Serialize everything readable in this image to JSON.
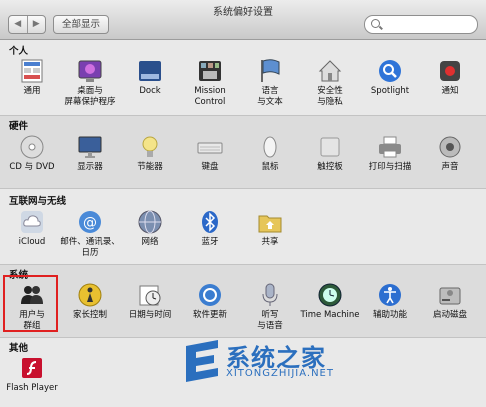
{
  "window": {
    "title": "系统偏好设置"
  },
  "toolbar": {
    "back_glyph": "◀",
    "forward_glyph": "▶",
    "show_all_label": "全部显示",
    "search_placeholder": ""
  },
  "sections": {
    "personal": {
      "title": "个人",
      "items": [
        {
          "label": "通用"
        },
        {
          "label": "桌面与\n屏幕保护程序"
        },
        {
          "label": "Dock"
        },
        {
          "label": "Mission\nControl"
        },
        {
          "label": "语言\n与文本"
        },
        {
          "label": "安全性\n与隐私"
        },
        {
          "label": "Spotlight"
        },
        {
          "label": "通知"
        }
      ]
    },
    "hardware": {
      "title": "硬件",
      "items": [
        {
          "label": "CD 与 DVD"
        },
        {
          "label": "显示器"
        },
        {
          "label": "节能器"
        },
        {
          "label": "键盘"
        },
        {
          "label": "鼠标"
        },
        {
          "label": "触控板"
        },
        {
          "label": "打印与扫描"
        },
        {
          "label": "声音"
        }
      ]
    },
    "internet": {
      "title": "互联网与无线",
      "items": [
        {
          "label": "iCloud"
        },
        {
          "label": "邮件、通讯录、\n日历"
        },
        {
          "label": "网络"
        },
        {
          "label": "蓝牙"
        },
        {
          "label": "共享"
        }
      ]
    },
    "system": {
      "title": "系统",
      "items": [
        {
          "label": "用户与\n群组"
        },
        {
          "label": "家长控制"
        },
        {
          "label": "日期与时间"
        },
        {
          "label": "软件更新"
        },
        {
          "label": "听写\n与语音"
        },
        {
          "label": "Time Machine"
        },
        {
          "label": "辅助功能"
        },
        {
          "label": "启动磁盘"
        }
      ]
    },
    "other": {
      "title": "其他",
      "items": [
        {
          "label": "Flash Player"
        }
      ]
    }
  },
  "watermark": {
    "main": "系统之家",
    "sub": "XITONGZHIJIA.NET"
  },
  "colors": {
    "selection_border": "#e02020",
    "watermark": "#2b6fbe"
  }
}
